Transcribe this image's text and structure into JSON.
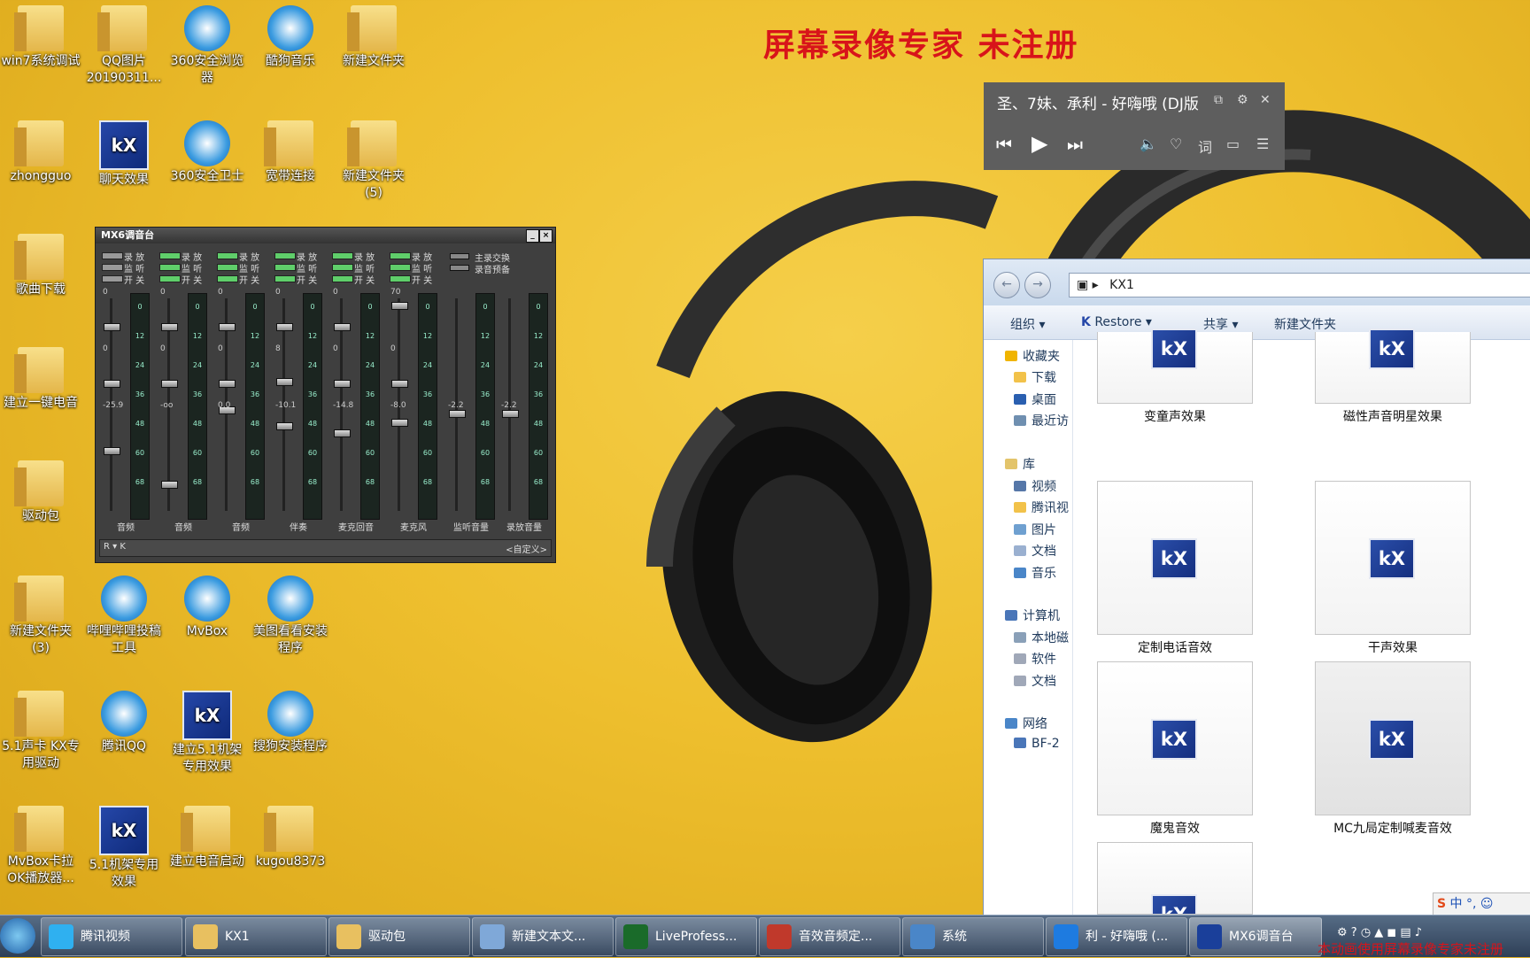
{
  "watermark": "屏幕录像专家  未注册",
  "desktop_icons": [
    {
      "label": "win7系统调试",
      "type": "folder"
    },
    {
      "label": "QQ图片20190311...",
      "type": "folder"
    },
    {
      "label": "360安全浏览器",
      "type": "round"
    },
    {
      "label": "酷狗音乐",
      "type": "round"
    },
    {
      "label": "新建文件夹",
      "type": "folder"
    },
    {
      "label": "zhongguo",
      "type": "folder"
    },
    {
      "label": "聊天效果",
      "type": "kx"
    },
    {
      "label": "360安全卫士",
      "type": "round"
    },
    {
      "label": "宽带连接",
      "type": "folder"
    },
    {
      "label": "新建文件夹 (5)",
      "type": "folder"
    },
    {
      "label": "歌曲下载",
      "type": "folder"
    },
    {
      "label": "建立一键电音",
      "type": "folder"
    },
    {
      "label": "驱动包",
      "type": "folder"
    },
    {
      "label": "新建文件夹 (3)",
      "type": "folder"
    },
    {
      "label": "哔哩哔哩投稿工具",
      "type": "round"
    },
    {
      "label": "MvBox",
      "type": "round"
    },
    {
      "label": "美图看看安装程序",
      "type": "round"
    },
    {
      "label": "5.1声卡 KX专用驱动",
      "type": "folder"
    },
    {
      "label": "腾讯QQ",
      "type": "round"
    },
    {
      "label": "建立5.1机架专用效果",
      "type": "kx"
    },
    {
      "label": "搜狗安装程序",
      "type": "round"
    },
    {
      "label": "MvBox卡拉OK播放器...",
      "type": "folder"
    },
    {
      "label": "5.1机架专用效果",
      "type": "kx"
    },
    {
      "label": "建立电音启动",
      "type": "folder"
    },
    {
      "label": "kugou8373",
      "type": "folder"
    }
  ],
  "player": {
    "title": "圣、7妹、承利 - 好嗨哦 (DJ版",
    "prev": "⏮",
    "play": "▶",
    "next": "⏭",
    "lyric_label": "词"
  },
  "mixer": {
    "title": "MX6调音台",
    "minimize": "_",
    "close": "×",
    "right_labels": [
      "主录交换",
      "录音预备"
    ],
    "switch_labels": [
      "录 放",
      "监 听",
      "开 关"
    ],
    "meter_ticks": [
      "0",
      "12",
      "24",
      "36",
      "48",
      "60",
      "68"
    ],
    "footer_left": "R ▾ K",
    "footer_right": "<自定义>",
    "channels": [
      {
        "name": "音频",
        "top": "0",
        "mid": "0",
        "val": "-25.9"
      },
      {
        "name": "音频",
        "top": "0",
        "mid": "0",
        "val": "-oo"
      },
      {
        "name": "音频",
        "top": "0",
        "mid": "0",
        "val": "0.0"
      },
      {
        "name": "伴奏",
        "top": "0",
        "mid": "8",
        "val": "-10.1"
      },
      {
        "name": "麦克回音",
        "top": "0",
        "mid": "0",
        "val": "-14.8"
      },
      {
        "name": "麦克风",
        "top": "70",
        "mid": "0",
        "val": "-8.0"
      },
      {
        "name": "监听音量",
        "top": "",
        "mid": "",
        "val": "-2.2"
      },
      {
        "name": "录放音量",
        "top": "",
        "mid": "",
        "val": "-2.2"
      }
    ]
  },
  "explorer": {
    "path": "KX1",
    "toolbar": {
      "organize": "组织 ▾",
      "restore": "Restore ▾",
      "share": "共享 ▾",
      "new_folder": "新建文件夹"
    },
    "sidebar": [
      "收藏夹",
      "下载",
      "桌面",
      "最近访",
      "库",
      "视频",
      "腾讯视",
      "图片",
      "文档",
      "音乐",
      "计算机",
      "本地磁",
      "软件",
      "文档",
      "网络",
      "BF-2"
    ],
    "files": [
      "变童声效果",
      "磁性声音明星效果",
      "定制电话音效",
      "干声效果",
      "魔鬼音效",
      "MC九局定制喊麦音效"
    ]
  },
  "taskbar": {
    "tasks": [
      "腾讯视频",
      "KX1",
      "驱动包",
      "新建文本文...",
      "LiveProfess...",
      "音效音频定...",
      "系统",
      "利 - 好嗨哦 (...",
      "MX6调音台"
    ],
    "ime": "中 °, ☺",
    "watermark": "本动画使用屏幕录像专家未注册"
  },
  "colors": {
    "watermark": "#d8141a",
    "desktop": "#eebf2e",
    "player_bg": "#5e5e5e"
  }
}
